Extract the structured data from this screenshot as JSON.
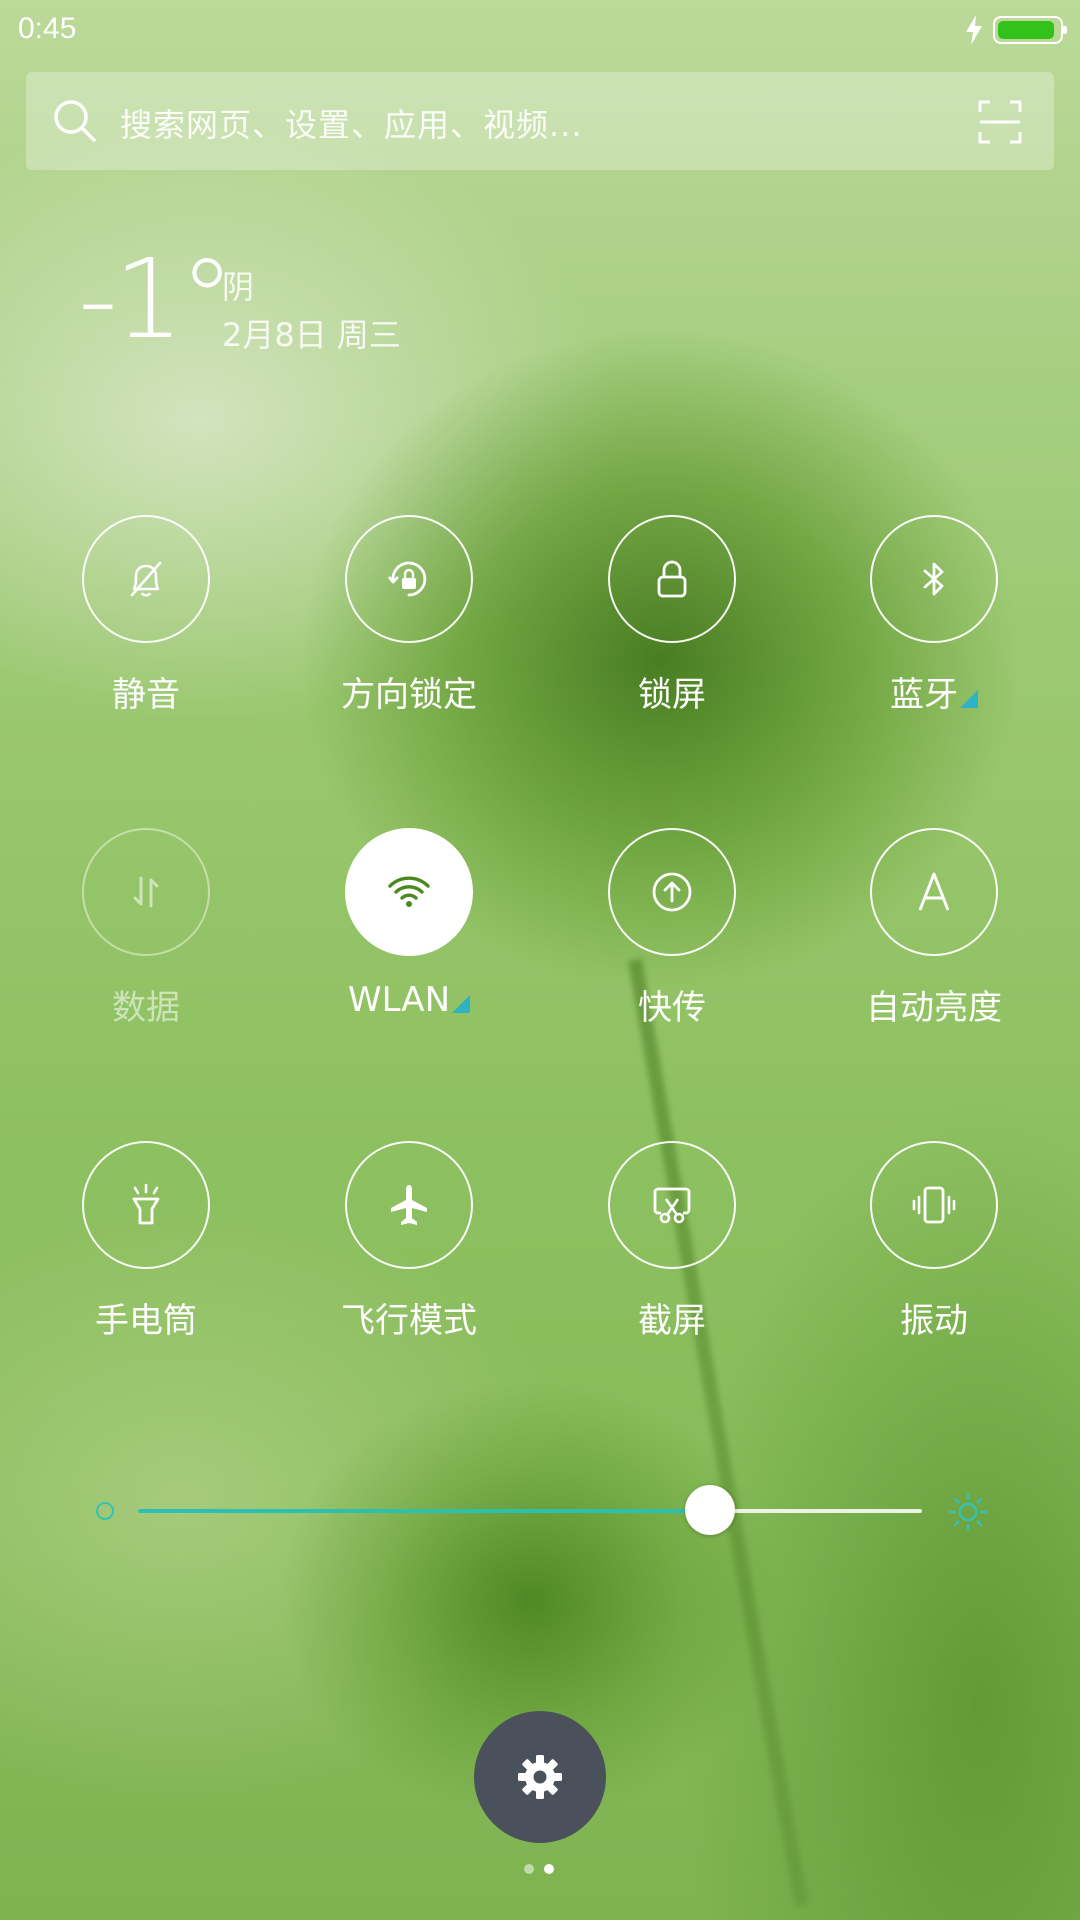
{
  "status_bar": {
    "time": "0:45",
    "battery_icon": "battery-charging-icon",
    "battery_color": "#33c21a"
  },
  "search": {
    "placeholder": "搜索网页、设置、应用、视频...",
    "icons": [
      "search-icon",
      "scan-icon"
    ]
  },
  "weather": {
    "temperature": "-1°",
    "condition": "阴",
    "date": "2月8日 周三"
  },
  "toggles": [
    {
      "label": "静音",
      "icon": "silent-bell-icon",
      "state": "off"
    },
    {
      "label": "方向锁定",
      "icon": "rotation-lock-icon",
      "state": "off"
    },
    {
      "label": "锁屏",
      "icon": "lock-icon",
      "state": "off"
    },
    {
      "label": "蓝牙",
      "icon": "bluetooth-icon",
      "state": "off",
      "has_more": true
    },
    {
      "label": "数据",
      "icon": "mobile-data-icon",
      "state": "disabled"
    },
    {
      "label": "WLAN",
      "icon": "wifi-icon",
      "state": "on",
      "has_more": true
    },
    {
      "label": "快传",
      "icon": "quick-transfer-icon",
      "state": "off"
    },
    {
      "label": "自动亮度",
      "icon": "auto-brightness-icon",
      "state": "off"
    },
    {
      "label": "手电筒",
      "icon": "flashlight-icon",
      "state": "off"
    },
    {
      "label": "飞行模式",
      "icon": "airplane-icon",
      "state": "off"
    },
    {
      "label": "截屏",
      "icon": "screenshot-icon",
      "state": "off"
    },
    {
      "label": "振动",
      "icon": "vibrate-icon",
      "state": "off"
    }
  ],
  "brightness": {
    "level": 0.73,
    "accent_color": "#2fbfae"
  },
  "settings": {
    "icon": "gear-icon"
  },
  "pager": {
    "pages": 2,
    "current": 2
  }
}
